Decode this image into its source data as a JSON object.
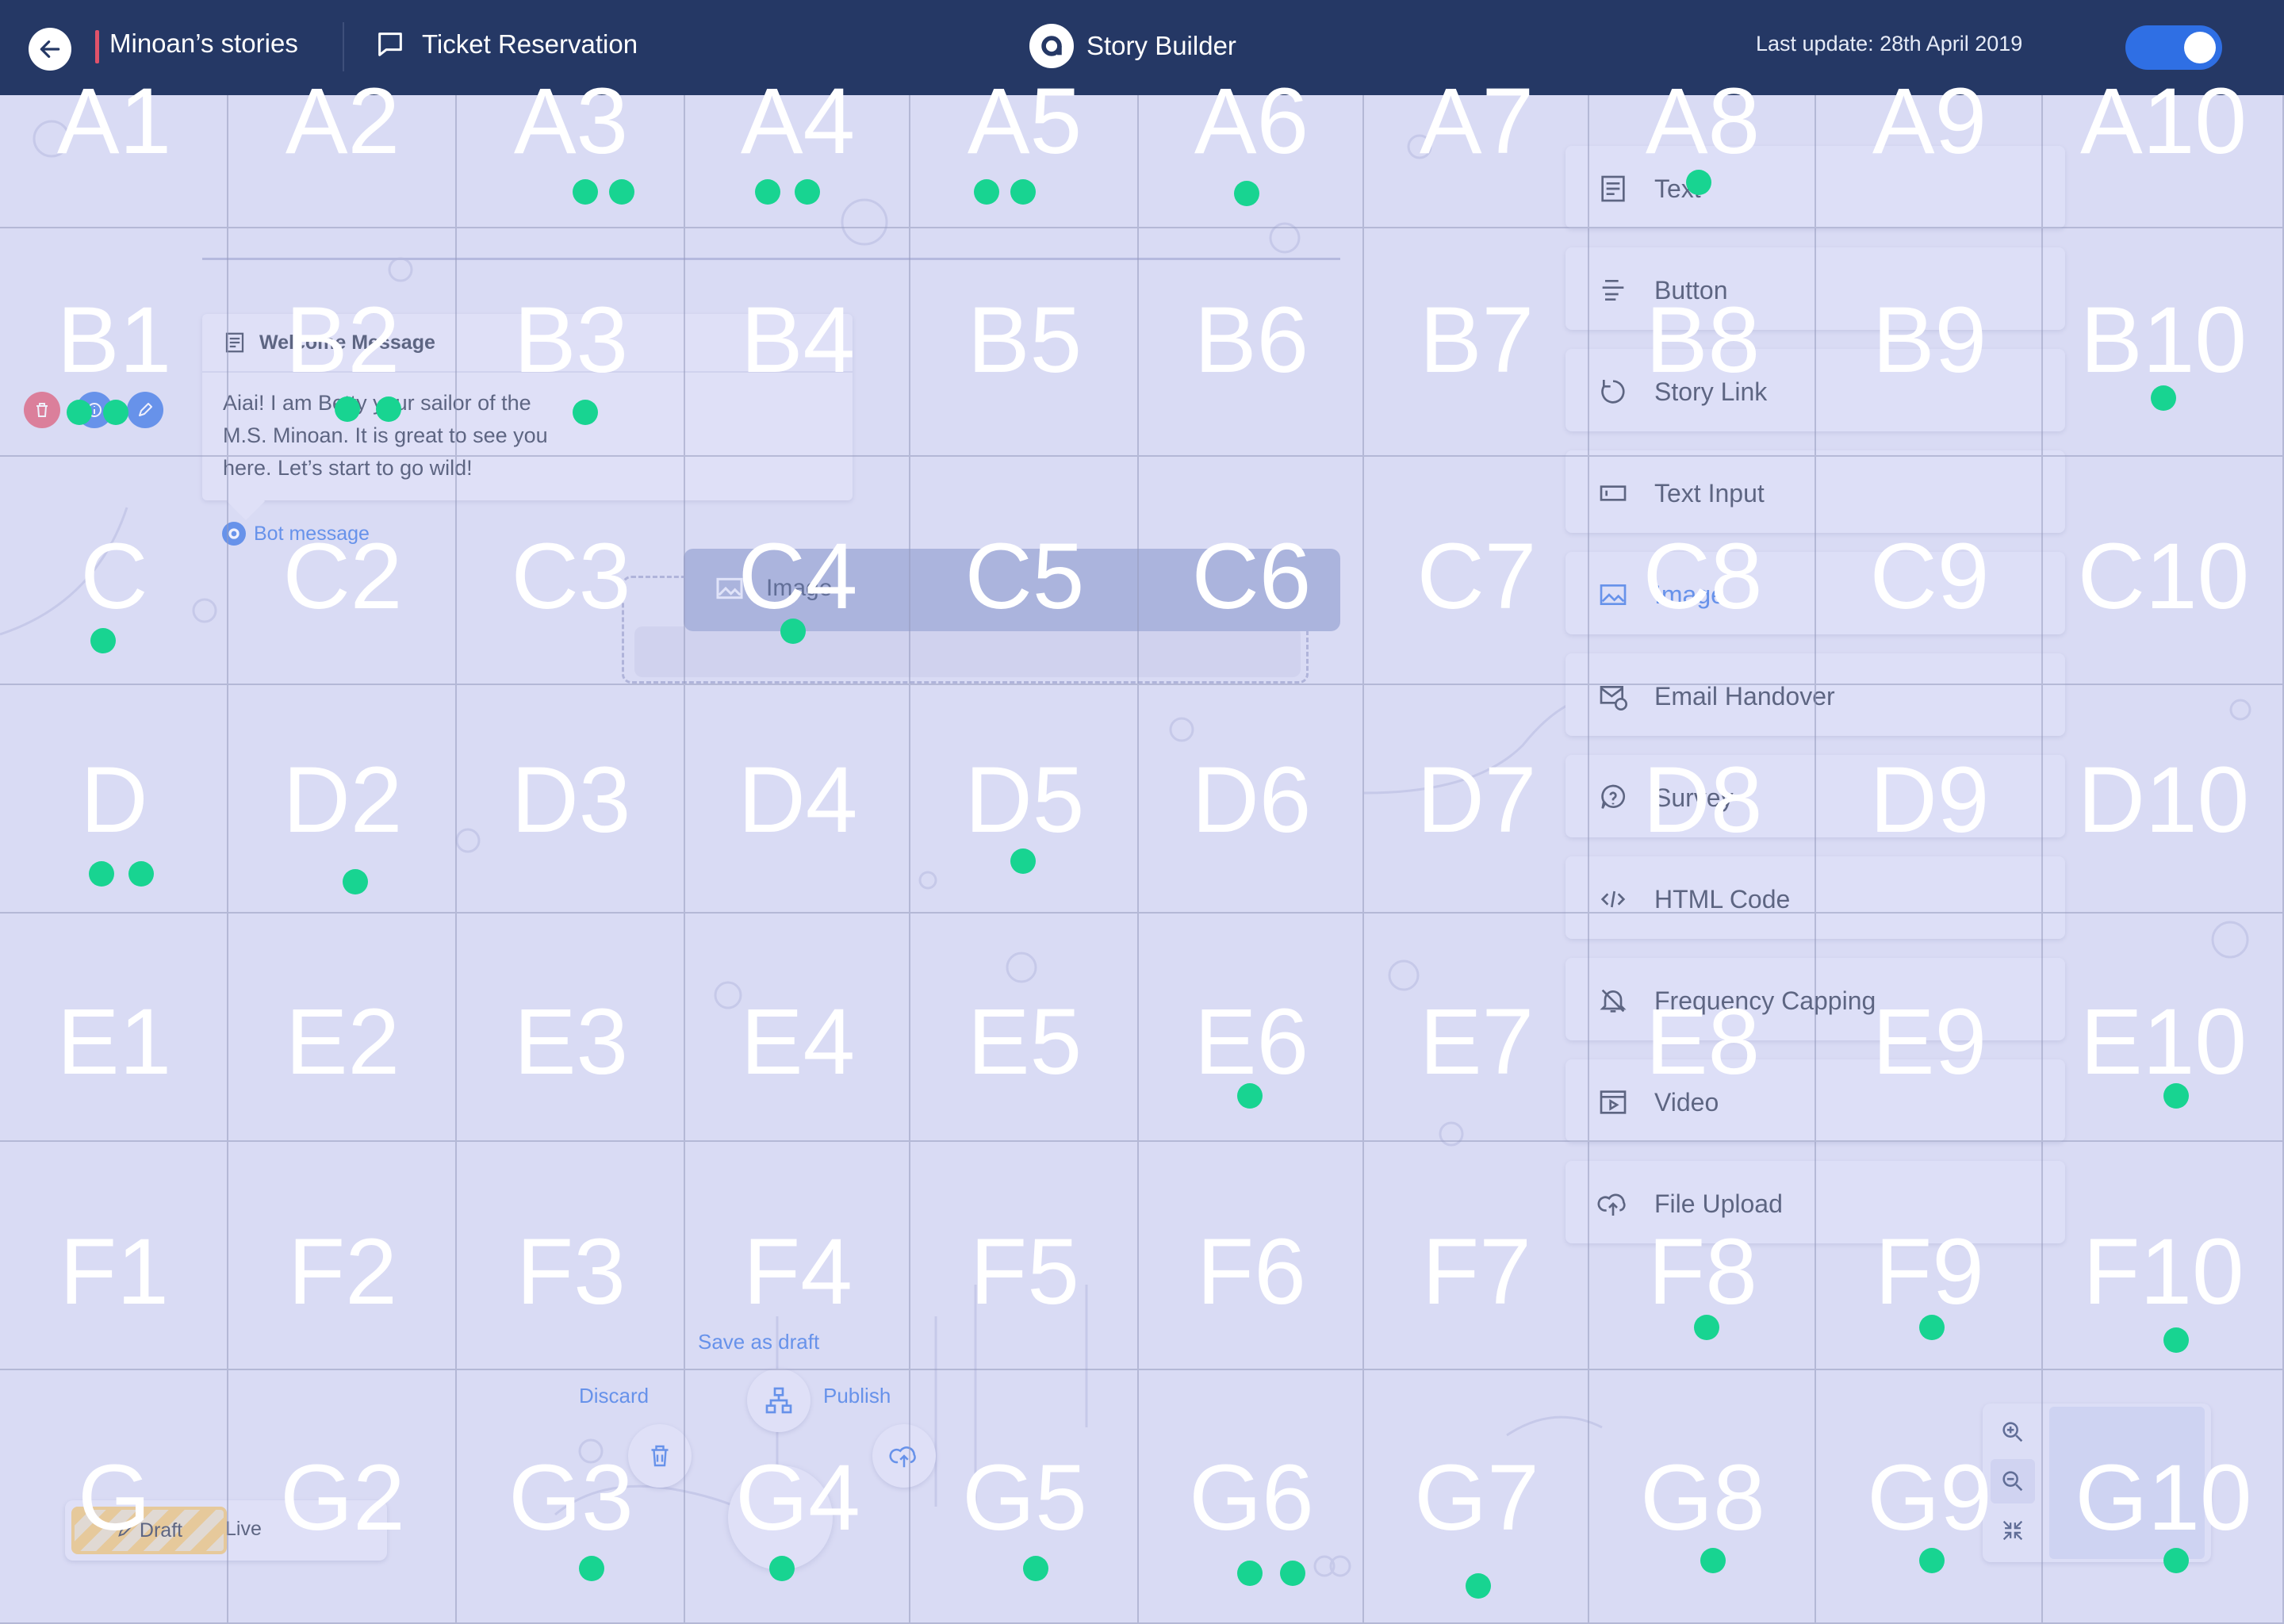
{
  "header": {
    "project_name": "Minoan’s stories",
    "story_name": "Ticket Reservation",
    "app_name": "Story Builder",
    "last_update": "Last update: 28th April 2019",
    "live_toggle_on": true
  },
  "welcome": {
    "title": "Welcome Message",
    "body": "Aiai! I am Betty your sailor of the M.S. Minoan. It is great to see you here. Let’s start to go wild!",
    "tag": "Bot message"
  },
  "dragging": {
    "label": "Image"
  },
  "components": [
    {
      "label": "Text",
      "icon": "text-block-icon"
    },
    {
      "label": "Button",
      "icon": "button-icon"
    },
    {
      "label": "Story Link",
      "icon": "story-link-icon"
    },
    {
      "label": "Text Input",
      "icon": "text-input-icon"
    },
    {
      "label": "Image",
      "icon": "image-icon",
      "active": true
    },
    {
      "label": "Email Handover",
      "icon": "email-handover-icon"
    },
    {
      "label": "Survey",
      "icon": "survey-icon"
    },
    {
      "label": "HTML Code",
      "icon": "html-code-icon"
    },
    {
      "label": "Frequency Capping",
      "icon": "frequency-capping-icon"
    },
    {
      "label": "Video",
      "icon": "video-icon"
    },
    {
      "label": "File Upload",
      "icon": "file-upload-icon"
    }
  ],
  "actions": {
    "save_draft": "Save as draft",
    "discard": "Discard",
    "publish": "Publish"
  },
  "mode": {
    "draft": "Draft",
    "live": "Live"
  },
  "grid": {
    "rows": [
      [
        "A1",
        "A2",
        "A3",
        "A4",
        "A5",
        "A6",
        "A7",
        "A8",
        "A9",
        "A10"
      ],
      [
        "B1",
        "B2",
        "B3",
        "B4",
        "B5",
        "B6",
        "B7",
        "B8",
        "B9",
        "B10"
      ],
      [
        "C",
        "C2",
        "C3",
        "C4",
        "C5",
        "C6",
        "C7",
        "C8",
        "C9",
        "C10"
      ],
      [
        "D",
        "D2",
        "D3",
        "D4",
        "D5",
        "D6",
        "D7",
        "D8",
        "D9",
        "D10"
      ],
      [
        "E1",
        "E2",
        "E3",
        "E4",
        "E5",
        "E6",
        "E7",
        "E8",
        "E9",
        "E10"
      ],
      [
        "F1",
        "F2",
        "F3",
        "F4",
        "F5",
        "F6",
        "F7",
        "F8",
        "F9",
        "F10"
      ],
      [
        "G",
        "G2",
        "G3",
        "G4",
        "G5",
        "G6",
        "G7",
        "G8",
        "G9",
        "G10"
      ]
    ]
  },
  "colors": {
    "header_bg": "#253865",
    "accent": "#2f6fe4",
    "marker": "#18d491",
    "danger": "#e0526a"
  }
}
